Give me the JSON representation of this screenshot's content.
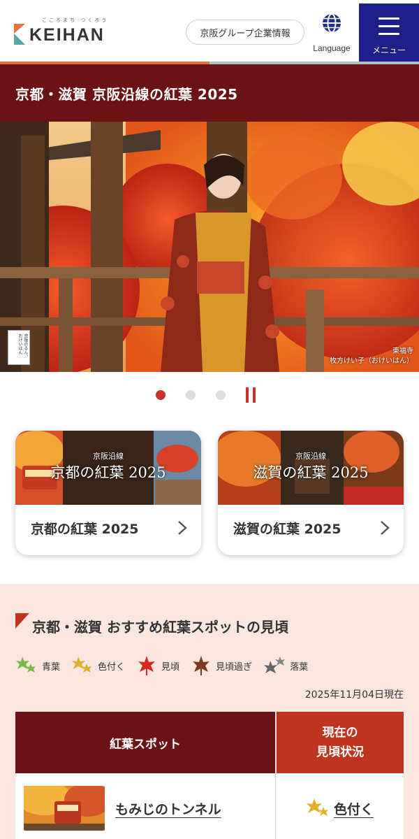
{
  "header": {
    "logo_tagline": "こころまち つくろう",
    "logo_text": "KEIHAN",
    "group_link": "京阪グループ企業情報",
    "language_label": "Language",
    "menu_label": "メニュー",
    "icons": {
      "globe": "globe-icon",
      "menu": "hamburger-icon"
    },
    "colors": {
      "menu_bg": "#1f1f8a",
      "accent_orange": "#e0733a",
      "accent_teal": "#a8c4c8"
    }
  },
  "page_title": "京都・滋賀 京阪沿線の紅葉 2025",
  "hero": {
    "caption_place": "東福寺",
    "caption_person": "枚方けい子（おけいはん）",
    "stamp_text": "京阪のるん、おけいはん",
    "slides": 3,
    "active_slide": 1
  },
  "cards": [
    {
      "thumb_sub": "京阪沿線",
      "thumb_title": "京都の紅葉 2025",
      "label": "京都の紅葉 2025"
    },
    {
      "thumb_sub": "京阪沿線",
      "thumb_title": "滋賀の紅葉 2025",
      "label": "滋賀の紅葉 2025"
    }
  ],
  "status_section": {
    "title": "京都・滋賀 おすすめ紅葉スポットの見頃",
    "legend": [
      {
        "label": "青葉",
        "icon": "green-leaf-icon",
        "color": "#7ab84a"
      },
      {
        "label": "色付く",
        "icon": "yellow-leaf-icon",
        "color": "#e0b12a"
      },
      {
        "label": "見頃",
        "icon": "red-leaf-icon",
        "color": "#d42a1e"
      },
      {
        "label": "見頃過ぎ",
        "icon": "brown-leaf-icon",
        "color": "#7a3b1a"
      },
      {
        "label": "落葉",
        "icon": "gray-leaf-icon",
        "color": "#777777"
      }
    ],
    "as_of": "2025年11月04日現在",
    "table": {
      "col_spot": "紅葉スポット",
      "col_status_line1": "現在の",
      "col_status_line2": "見頃状況",
      "rows": [
        {
          "spot": "もみじのトンネル",
          "status": "色付く",
          "status_icon": "yellow-leaf-icon"
        }
      ]
    }
  }
}
